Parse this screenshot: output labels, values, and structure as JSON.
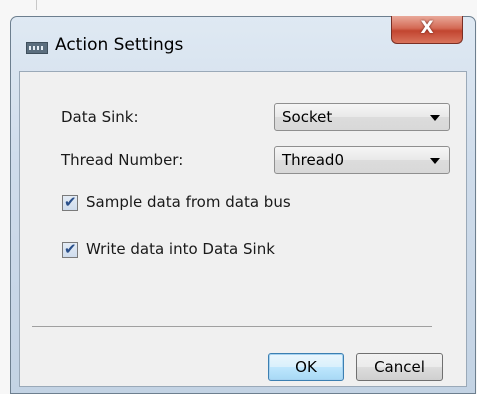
{
  "window": {
    "title": "Action Settings",
    "close_label": "X"
  },
  "form": {
    "data_sink_label": "Data Sink:",
    "data_sink_value": "Socket",
    "thread_number_label": "Thread Number:",
    "thread_number_value": "Thread0"
  },
  "options": [
    {
      "label": "Sample data from data bus",
      "checked": true
    },
    {
      "label": "Write data into Data Sink",
      "checked": true
    }
  ],
  "buttons": {
    "ok_label": "OK",
    "cancel_label": "Cancel"
  },
  "icons": {
    "app": "app-icon",
    "close": "close-icon",
    "dropdown": "chevron-down-icon",
    "check": "checkmark-icon"
  },
  "colors": {
    "close_button": "#c24530",
    "ok_button_border": "#3c7fb1",
    "checkmark": "#2a4f8a"
  }
}
